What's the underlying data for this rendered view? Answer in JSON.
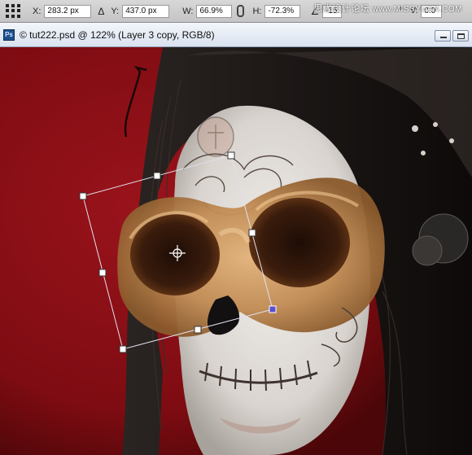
{
  "options_bar": {
    "x_label": "X:",
    "x_value": "283.2 px",
    "y_label": "Y:",
    "y_value": "437.0 px",
    "w_label": "W:",
    "w_value": "66.9%",
    "h_label": "H:",
    "h_value": "-72.3%",
    "angle_value": "-15.",
    "h_skew_label": "°",
    "v_skew_label": "V:",
    "v_skew_value": "0.0",
    "watermark_cn": "思缘设计论坛",
    "watermark_site": "www.MISSYUAN.COM"
  },
  "document": {
    "title": "© tut222.psd @ 122% (Layer 3 copy, RGB/8)",
    "zoom_percent": 122,
    "layer": "Layer 3 copy",
    "mode": "RGB/8"
  },
  "colors": {
    "background_red": "#8b0d14",
    "transform_box": "#d8d8e8",
    "handle_fill": "#ffffff",
    "anchor_handle": "#5a4fcf",
    "skin_paint": "#e8e4df",
    "bone_ochre": "#c08a52"
  },
  "icons": {
    "reference_point": "reference-point-grid-icon",
    "delta": "delta-icon",
    "link": "link-chain-icon",
    "rotate": "angle-icon",
    "app_badge": "photoshop-badge-icon",
    "center_point": "crosshair-icon"
  }
}
